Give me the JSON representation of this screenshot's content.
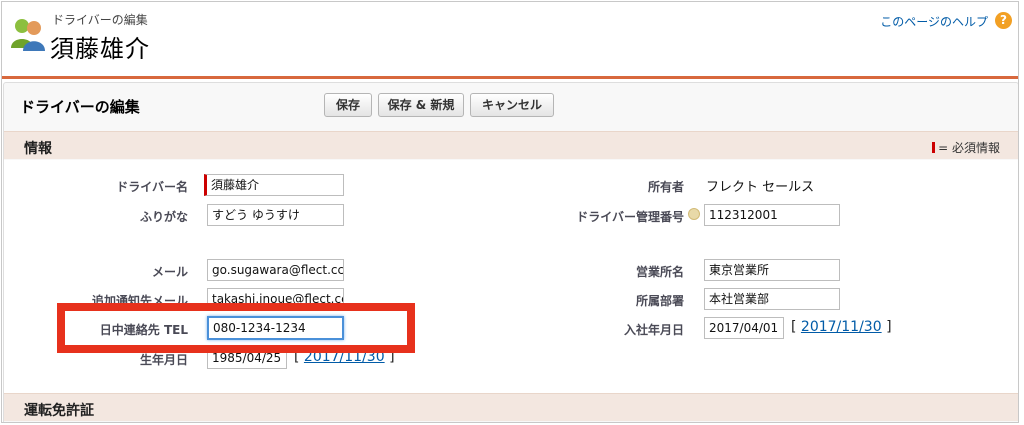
{
  "header": {
    "subtitle": "ドライバーの編集",
    "title": "須藤雄介",
    "help_link": "このページのヘルプ",
    "help_icon": "?"
  },
  "page": {
    "title": "ドライバーの編集",
    "buttons": {
      "save": "保存",
      "save_new": "保存 & 新規",
      "cancel": "キャンセル"
    }
  },
  "section_info": {
    "title": "情報",
    "required_legend": "= 必須情報"
  },
  "form": {
    "driver_name": {
      "label": "ドライバー名",
      "value": "須藤雄介"
    },
    "furigana": {
      "label": "ふりがな",
      "value": "すどう ゆうすけ"
    },
    "email": {
      "label": "メール",
      "value": "go.sugawara@flect.cc"
    },
    "extra_email": {
      "label": "追加通知先メール",
      "value": "takashi.inoue@flect.cc"
    },
    "day_tel": {
      "label": "日中連絡先 TEL",
      "value": "080-1234-1234"
    },
    "birthday": {
      "label": "生年月日",
      "value": "1985/04/25",
      "today_link": "2017/11/30"
    },
    "owner": {
      "label": "所有者",
      "value": "フレクト セールス"
    },
    "mgmt_no": {
      "label": "ドライバー管理番号",
      "value": "112312001"
    },
    "office": {
      "label": "営業所名",
      "value": "東京営業所"
    },
    "department": {
      "label": "所属部署",
      "value": "本社営業部"
    },
    "join_date": {
      "label": "入社年月日",
      "value": "2017/04/01",
      "today_link": "2017/11/30"
    }
  },
  "section_license": {
    "title": "運転免許証"
  },
  "colors": {
    "accent_line": "#d8683d",
    "highlight_box": "#e7311c",
    "section_bg": "#f3e7e0",
    "link": "#015ba7"
  },
  "icons": {
    "avatar": "users-icon",
    "help": "help-icon",
    "field_info": "info-icon"
  }
}
